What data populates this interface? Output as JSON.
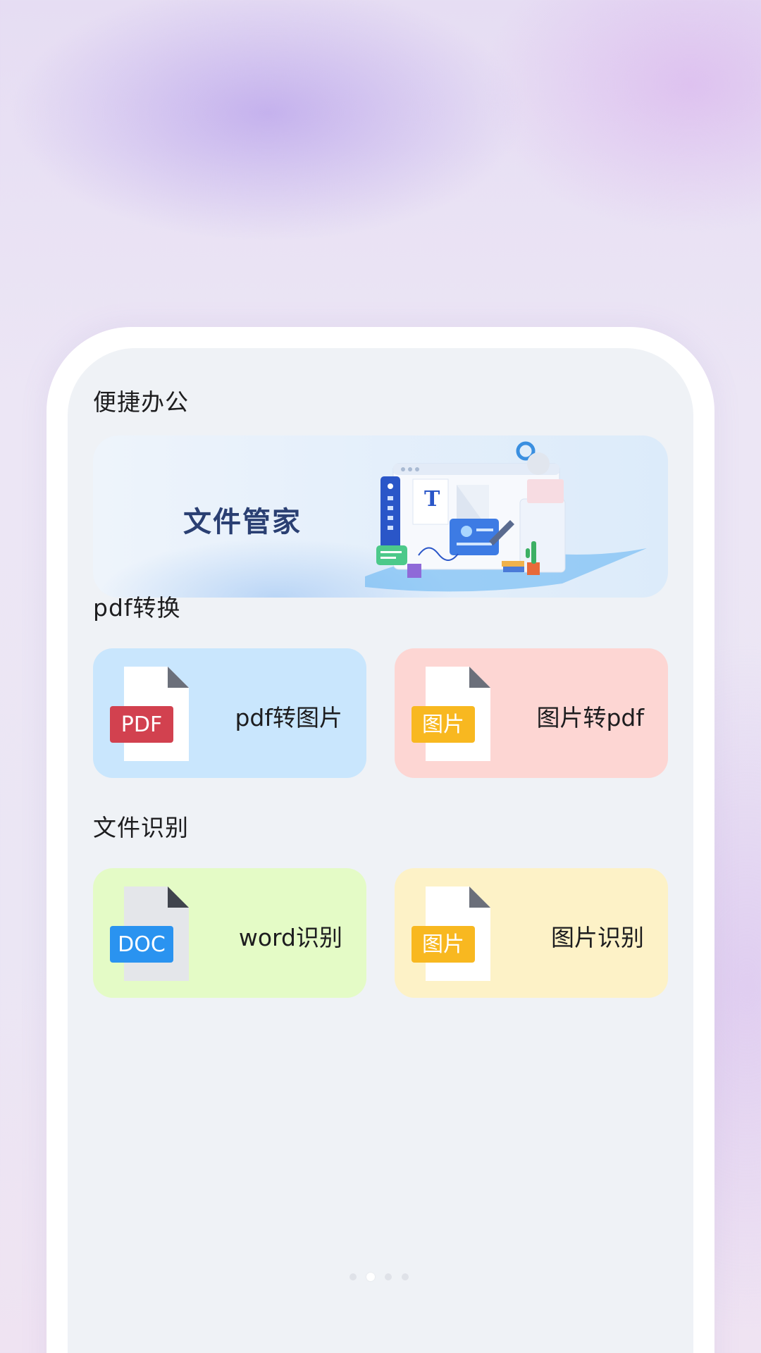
{
  "sections": {
    "office": {
      "title": "便捷办公"
    },
    "pdf_convert": {
      "title": "pdf转换"
    },
    "file_recognition": {
      "title": "文件识别"
    }
  },
  "banner": {
    "title": "文件管家",
    "art_letter": "T"
  },
  "cards": {
    "pdf_to_image": {
      "label": "pdf转图片",
      "badge": "PDF",
      "badge_color": "#d2414f",
      "bg": "#c9e6fd"
    },
    "image_to_pdf": {
      "label": "图片转pdf",
      "badge": "图片",
      "badge_color": "#f8b820",
      "bg": "#fdd6d3"
    },
    "word_recognition": {
      "label": "word识别",
      "badge": "DOC",
      "badge_color": "#2a93f0",
      "bg": "#e4fbc6"
    },
    "image_recognition": {
      "label": "图片识别",
      "badge": "图片",
      "badge_color": "#f8b820",
      "bg": "#fdf2c7"
    }
  },
  "pager": {
    "count": 4,
    "active_index": 1
  },
  "icons": {
    "pdf_card": "pdf-file-icon",
    "image_card": "image-file-icon",
    "doc_card": "doc-file-icon"
  }
}
